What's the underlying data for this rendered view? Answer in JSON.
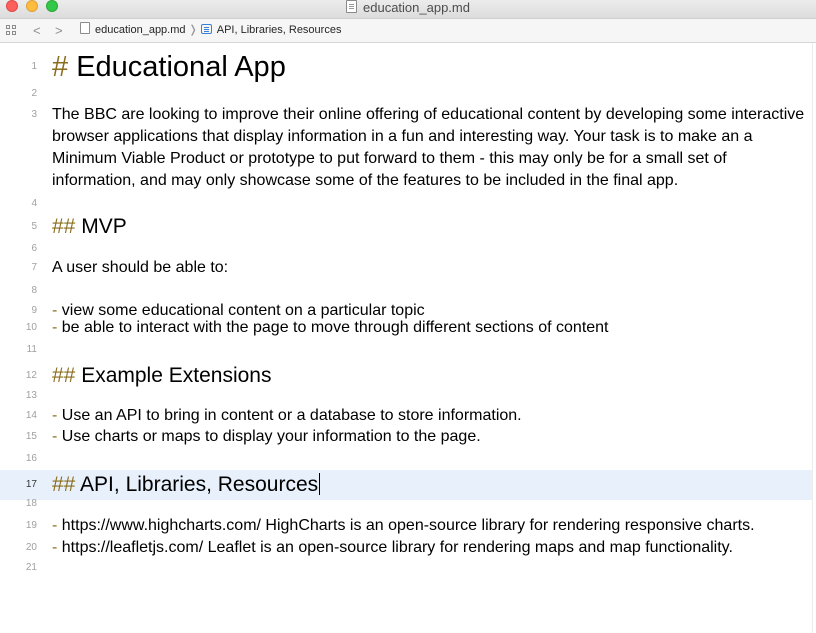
{
  "window": {
    "title": "education_app.md",
    "icon": "document-icon",
    "controls": [
      "close",
      "minimize",
      "zoom"
    ]
  },
  "jumpbar": {
    "back": "<",
    "forward": ">",
    "file": "education_app.md",
    "separator": "❭",
    "heading": "API, Libraries, Resources"
  },
  "editor": {
    "current_line": 17,
    "lines": [
      {
        "num": "1",
        "marker": "#",
        "text": "Educational App",
        "kind": "h1"
      },
      {
        "num": "2",
        "marker": "",
        "text": "",
        "kind": "blank"
      },
      {
        "num": "3",
        "marker": "",
        "text": "The BBC are looking to improve their online offering of educational content by developing some interactive",
        "kind": "para"
      },
      {
        "num": "",
        "marker": "",
        "text": "browser applications that display information in a fun and interesting way. Your task is to make an a",
        "kind": "wrap"
      },
      {
        "num": "",
        "marker": "",
        "text": "Minimum Viable Product or prototype to put forward to them - this may only be for a small set of",
        "kind": "wrap"
      },
      {
        "num": "",
        "marker": "",
        "text": "information, and may only showcase some of the features to be included in the final app.",
        "kind": "wrap"
      },
      {
        "num": "4",
        "marker": "",
        "text": "",
        "kind": "blank"
      },
      {
        "num": "5",
        "marker": "##",
        "text": "MVP",
        "kind": "h2"
      },
      {
        "num": "6",
        "marker": "",
        "text": "",
        "kind": "blank"
      },
      {
        "num": "7",
        "marker": "",
        "text": "A user should be able to:",
        "kind": "para"
      },
      {
        "num": "8",
        "marker": "",
        "text": "",
        "kind": "blank"
      },
      {
        "num": "9",
        "marker": "-",
        "text": "view some educational content on a particular topic",
        "kind": "li"
      },
      {
        "num": "10",
        "marker": "-",
        "text": "be able to interact with the page to move through different sections of content",
        "kind": "li"
      },
      {
        "num": "11",
        "marker": "",
        "text": "",
        "kind": "blank"
      },
      {
        "num": "12",
        "marker": "##",
        "text": "Example Extensions",
        "kind": "h2"
      },
      {
        "num": "13",
        "marker": "",
        "text": "",
        "kind": "blank"
      },
      {
        "num": "14",
        "marker": "-",
        "text": "Use an API to bring in content or a database to store information.",
        "kind": "li"
      },
      {
        "num": "15",
        "marker": "-",
        "text": "Use charts or maps to display your information to the page.",
        "kind": "li"
      },
      {
        "num": "16",
        "marker": "",
        "text": "",
        "kind": "blank"
      },
      {
        "num": "17",
        "marker": "##",
        "text": "API, Libraries, Resources",
        "kind": "h2"
      },
      {
        "num": "18",
        "marker": "",
        "text": "",
        "kind": "blank"
      },
      {
        "num": "19",
        "marker": "-",
        "text": "https://www.highcharts.com/ HighCharts is an open-source library for rendering responsive charts.",
        "kind": "li"
      },
      {
        "num": "20",
        "marker": "-",
        "text": "https://leafletjs.com/ Leaflet is an open-source library for rendering maps and map functionality.",
        "kind": "li"
      },
      {
        "num": "21",
        "marker": "",
        "text": "",
        "kind": "blank"
      }
    ]
  },
  "colors": {
    "markdown_marker": "#8a6d1c",
    "current_line_highlight": "#e8f1fb",
    "line_number": "#a0a0a0"
  }
}
